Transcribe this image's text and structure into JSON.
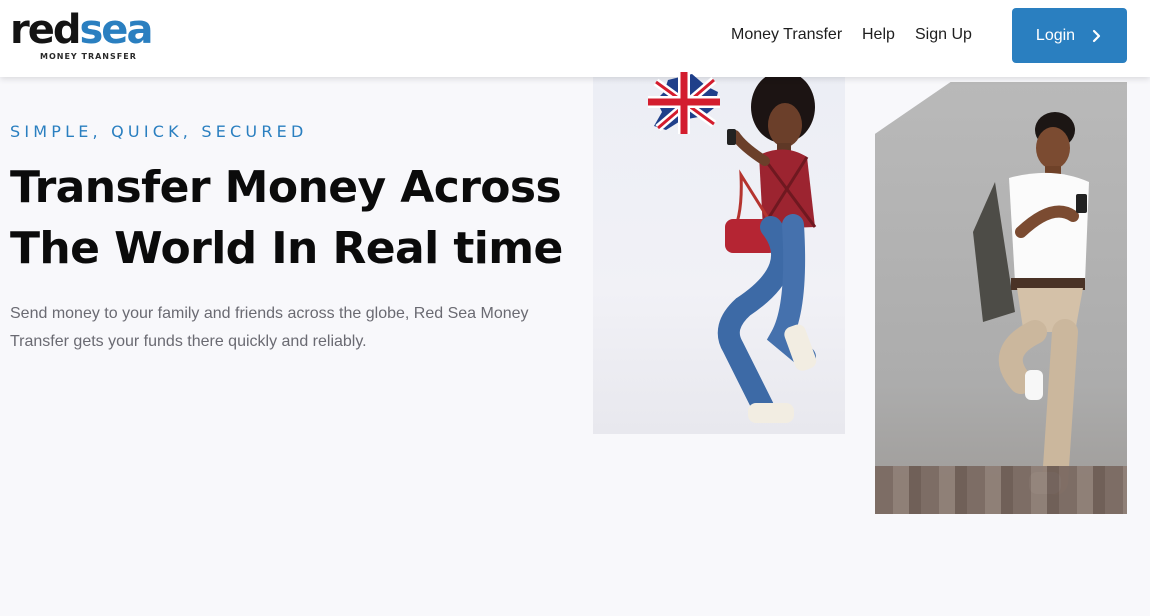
{
  "header": {
    "logo": {
      "word_part1": "red",
      "word_part2": "sea",
      "subtitle": "MONEY TRANSFER"
    },
    "nav": [
      {
        "label": "Money Transfer"
      },
      {
        "label": "Help"
      },
      {
        "label": "Sign Up"
      }
    ],
    "login_label": "Login"
  },
  "hero": {
    "tagline": "SIMPLE, QUICK, SECURED",
    "headline_line1": "Transfer Money Across",
    "headline_line2": "The World In Real time",
    "description": "Send money to your family and friends across the globe, Red Sea Money Transfer gets your funds there quickly and reliably."
  },
  "images": {
    "photo1_alt": "woman-with-phone-photo",
    "photo2_alt": "man-with-phone-photo",
    "flag_icon": "uk-flag-icon"
  },
  "colors": {
    "accent": "#2a7fc0",
    "headline": "#0b0b0b",
    "body_text": "#6a6a72",
    "background": "#f8f8fb"
  }
}
